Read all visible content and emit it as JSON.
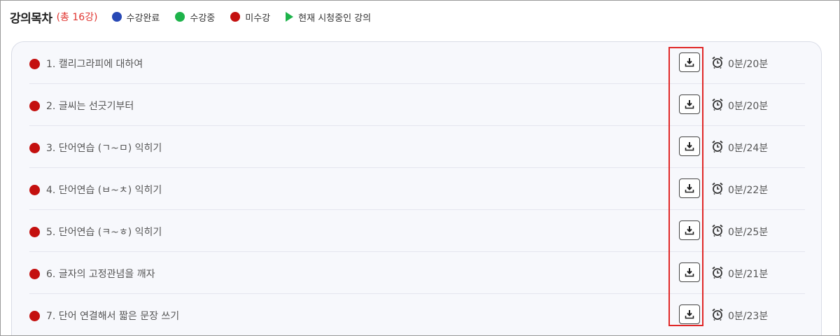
{
  "header": {
    "title": "강의목차",
    "count": "(총 16강)"
  },
  "legend": [
    {
      "label": "수강완료",
      "type": "dot",
      "color": "#2748b5"
    },
    {
      "label": "수강중",
      "type": "dot",
      "color": "#1db34a"
    },
    {
      "label": "미수강",
      "type": "dot",
      "color": "#c4100f"
    },
    {
      "label": "현재 시청중인 강의",
      "type": "play",
      "color": "#1db34a"
    }
  ],
  "lectures": [
    {
      "title": "1. 캘리그라피에 대하여",
      "status": "미수강",
      "time": "0분/20분"
    },
    {
      "title": "2. 글씨는 선긋기부터",
      "status": "미수강",
      "time": "0분/20분"
    },
    {
      "title": "3. 단어연습 (ㄱ~ㅁ) 익히기",
      "status": "미수강",
      "time": "0분/24분"
    },
    {
      "title": "4. 단어연습 (ㅂ~ㅊ) 익히기",
      "status": "미수강",
      "time": "0분/22분"
    },
    {
      "title": "5. 단어연습 (ㅋ~ㅎ) 익히기",
      "status": "미수강",
      "time": "0분/25분"
    },
    {
      "title": "6. 글자의 고정관념을 깨자",
      "status": "미수강",
      "time": "0분/21분"
    },
    {
      "title": "7. 단어 연결해서 짧은 문장 쓰기",
      "status": "미수강",
      "time": "0분/23분"
    }
  ],
  "icons": {
    "status_bullet": "red-dot-icon",
    "download": "download-icon",
    "clock": "alarm-clock-icon"
  },
  "colors": {
    "not_started": "#c4100f",
    "count_text": "#e0342f",
    "highlight_border": "#e02828"
  }
}
